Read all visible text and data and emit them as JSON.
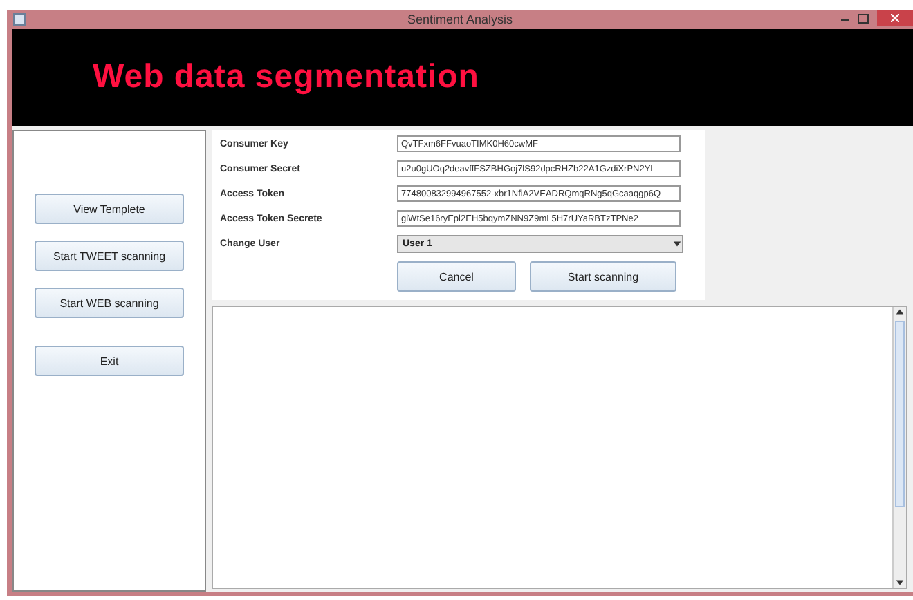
{
  "window": {
    "title": "Sentiment Analysis"
  },
  "banner": {
    "title": "Web data segmentation"
  },
  "sidebar": {
    "buttons": [
      "View Templete",
      "Start TWEET scanning",
      "Start WEB scanning",
      "Exit"
    ]
  },
  "form": {
    "fields": [
      {
        "label": "Consumer Key",
        "value": "QvTFxm6FFvuaoTIMK0H60cwMF"
      },
      {
        "label": "Consumer Secret",
        "value": "u2u0gUOq2deavffFSZBHGoj7lS92dpcRHZb22A1GzdiXrPN2YL"
      },
      {
        "label": "Access Token",
        "value": "774800832994967552-xbr1NfiA2VEADRQmqRNg5qGcaaqgp6Q"
      },
      {
        "label": "Access Token Secrete",
        "value": "giWtSe16ryEpl2EH5bqymZNN9Z9mL5H7rUYaRBTzTPNe2"
      }
    ],
    "user": {
      "label": "Change User",
      "value": "User 1"
    },
    "buttons": [
      "Cancel",
      "Start scanning"
    ]
  }
}
